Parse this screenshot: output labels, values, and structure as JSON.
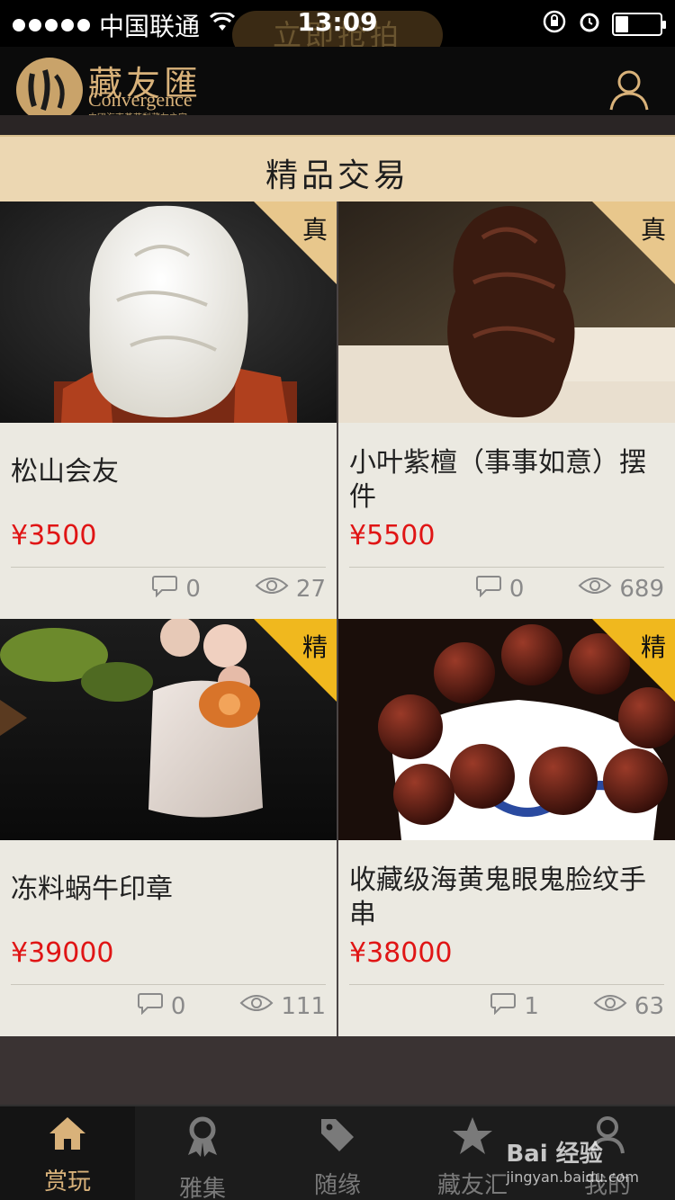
{
  "status_bar": {
    "carrier": "中国联通",
    "time": "13:09",
    "wifi_icon": "wifi-icon",
    "lock_icon": "rotation-lock-icon",
    "alarm_icon": "alarm-icon",
    "battery_level": 0.25
  },
  "overlay_button": {
    "label": "立即抢拍"
  },
  "header": {
    "logo_cn": "藏友匯",
    "logo_en": "Convergence",
    "logo_sub": "中國海南黃花梨藏友之家",
    "user_icon": "user-icon"
  },
  "section": {
    "title": "精品交易"
  },
  "products": [
    {
      "title": "松山会友",
      "price": "¥3500",
      "badge": "真",
      "comments": "0",
      "views": "27"
    },
    {
      "title": "小叶紫檀（事事如意）摆件",
      "price": "¥5500",
      "badge": "真",
      "comments": "0",
      "views": "689"
    },
    {
      "title": "冻料蜗牛印章",
      "price": "¥39000",
      "badge": "精",
      "comments": "0",
      "views": "111"
    },
    {
      "title": "收藏级海黄鬼眼鬼脸纹手串",
      "price": "¥38000",
      "badge": "精",
      "comments": "1",
      "views": "63"
    }
  ],
  "tabs": [
    {
      "label": "赏玩",
      "icon": "home-icon",
      "active": true
    },
    {
      "label": "雅集",
      "icon": "award-icon",
      "active": false
    },
    {
      "label": "随缘",
      "icon": "tag-icon",
      "active": false
    },
    {
      "label": "藏友汇",
      "icon": "star-icon",
      "active": false
    },
    {
      "label": "我的",
      "icon": "user-icon",
      "active": false
    }
  ],
  "watermark": {
    "brand": "Bai 经验",
    "url": "jingyan.baidu.com"
  },
  "colors": {
    "accent": "#d9b27a",
    "price": "#e01515",
    "badge_true": "#e8c78c",
    "badge_fine": "#f0b81e"
  }
}
